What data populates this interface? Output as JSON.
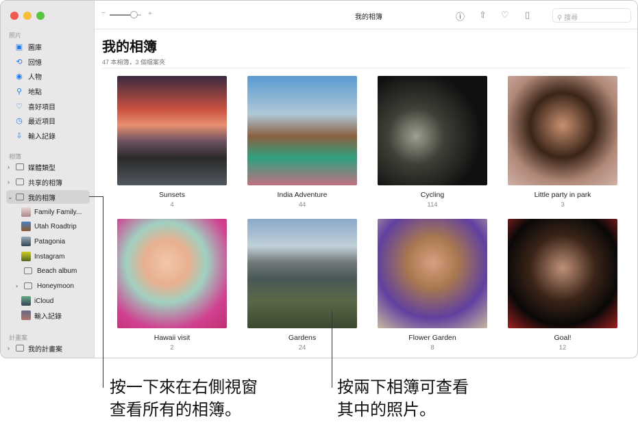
{
  "window_title": "我的相簿",
  "sidebar": {
    "section_photos": "照片",
    "photos_items": [
      {
        "label": "圖庫",
        "icon": "library-icon"
      },
      {
        "label": "回憶",
        "icon": "memories-icon"
      },
      {
        "label": "人物",
        "icon": "people-icon"
      },
      {
        "label": "地點",
        "icon": "places-icon"
      },
      {
        "label": "喜好項目",
        "icon": "heart-icon"
      },
      {
        "label": "最近項目",
        "icon": "clock-icon"
      },
      {
        "label": "輸入記錄",
        "icon": "import-icon"
      }
    ],
    "section_albums": "相簿",
    "album_items": [
      {
        "label": "媒體類型"
      },
      {
        "label": "共享的相簿"
      },
      {
        "label": "我的相簿"
      }
    ],
    "my_albums": [
      {
        "label": "Family Family..."
      },
      {
        "label": "Utah Roadtrip"
      },
      {
        "label": "Patagonia"
      },
      {
        "label": "Instagram"
      },
      {
        "label": "Beach album"
      },
      {
        "label": "Honeymoon"
      },
      {
        "label": "iCloud"
      },
      {
        "label": "輸入記錄"
      }
    ],
    "section_projects": "計畫案",
    "projects_items": [
      {
        "label": "我的計畫案"
      }
    ]
  },
  "toolbar": {
    "search_placeholder": "搜尋",
    "zoom_minus": "−",
    "zoom_plus": "+",
    "zoom_level": 0.75
  },
  "main": {
    "title": "我的相簿",
    "subtitle": "47 本相簿，3 個檔案夾",
    "albums": [
      {
        "title": "Sunsets",
        "count": "4"
      },
      {
        "title": "India Adventure",
        "count": "44"
      },
      {
        "title": "Cycling",
        "count": "114"
      },
      {
        "title": "Little party in park",
        "count": "3"
      },
      {
        "title": "Hawaii visit",
        "count": "2"
      },
      {
        "title": "Gardens",
        "count": "24"
      },
      {
        "title": "Flower Garden",
        "count": "8"
      },
      {
        "title": "Goal!",
        "count": "12"
      }
    ]
  },
  "callouts": {
    "left": [
      "按一下來在右側視窗",
      "查看所有的相簿。"
    ],
    "right": [
      "按兩下相簿可查看",
      "其中的照片。"
    ]
  }
}
